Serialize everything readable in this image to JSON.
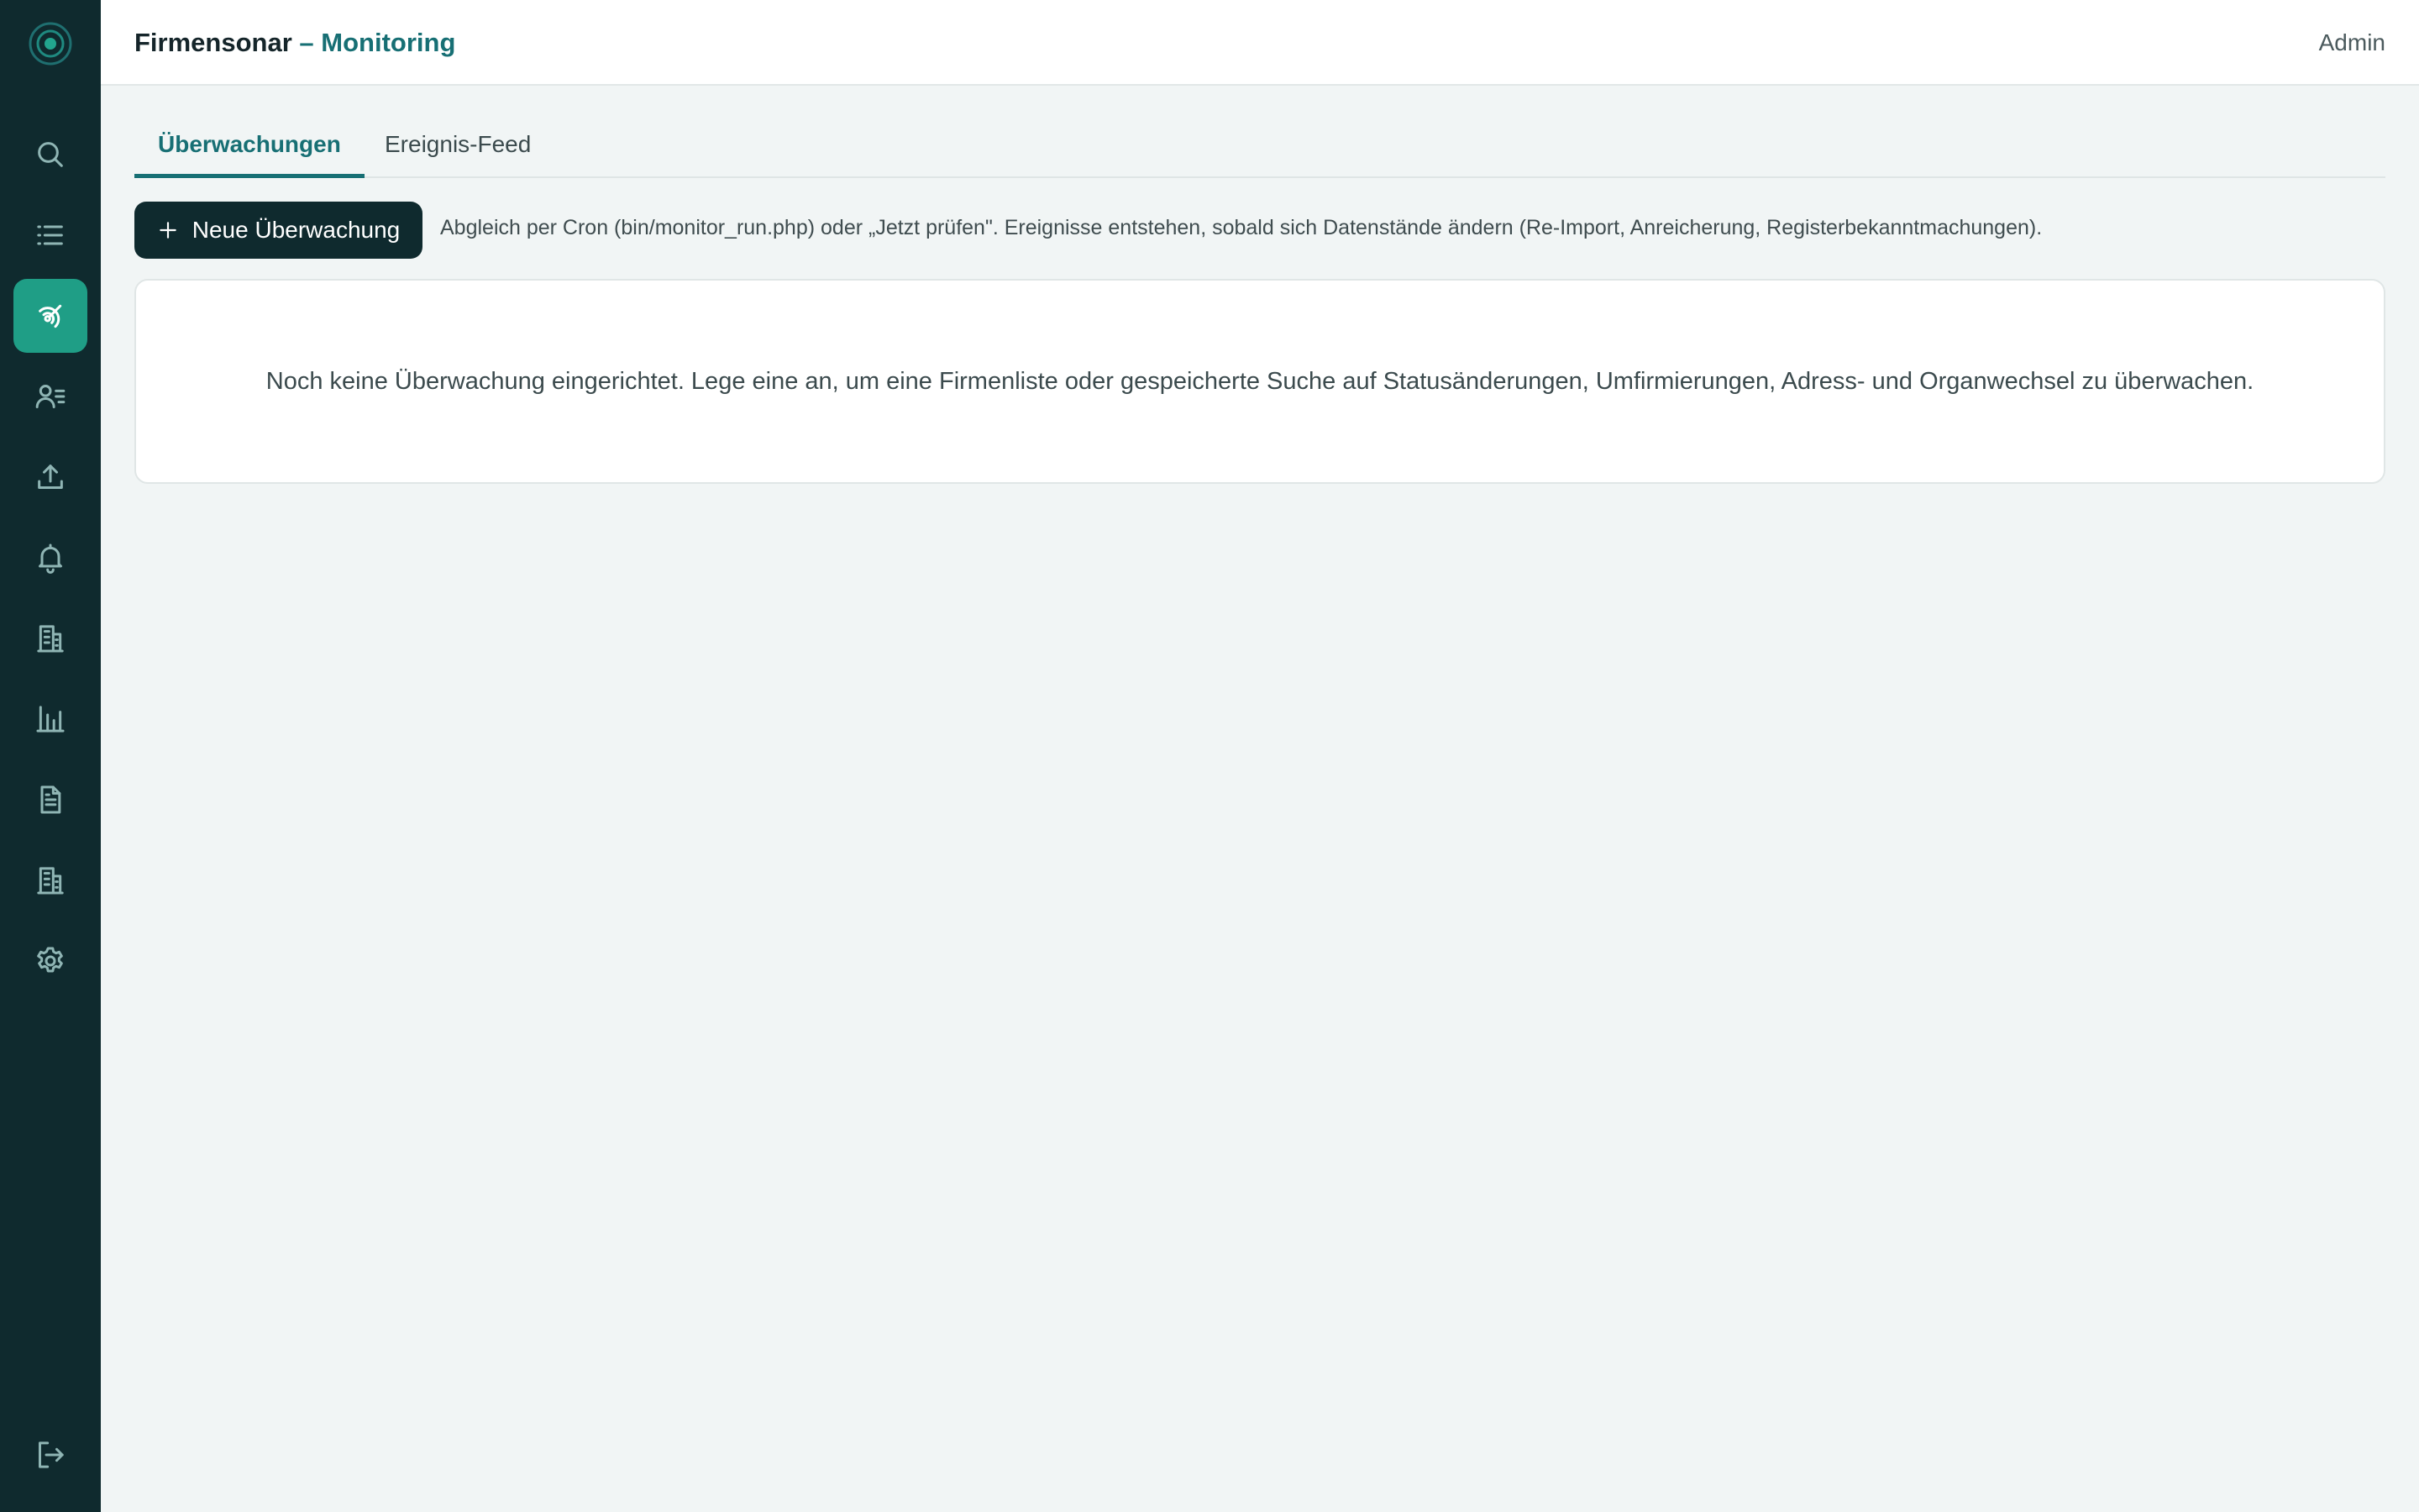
{
  "header": {
    "app_name": "Firmensonar",
    "section": "– Monitoring",
    "user": "Admin"
  },
  "sidebar": {
    "items": [
      {
        "icon": "search-icon",
        "active": false
      },
      {
        "icon": "list-icon",
        "active": false
      },
      {
        "icon": "radar-icon",
        "active": true
      },
      {
        "icon": "contacts-icon",
        "active": false
      },
      {
        "icon": "upload-icon",
        "active": false
      },
      {
        "icon": "bell-icon",
        "active": false
      },
      {
        "icon": "building-icon",
        "active": false
      },
      {
        "icon": "bar-chart-icon",
        "active": false
      },
      {
        "icon": "document-icon",
        "active": false
      },
      {
        "icon": "building-icon",
        "active": false
      },
      {
        "icon": "gear-icon",
        "active": false
      },
      {
        "icon": "logout-icon",
        "active": false
      }
    ]
  },
  "tabs": [
    {
      "label": "Überwachungen",
      "active": true
    },
    {
      "label": "Ereignis-Feed",
      "active": false
    }
  ],
  "toolbar": {
    "new_button_label": "Neue Überwachung",
    "hint": "Abgleich per Cron (bin/monitor_run.php) oder „Jetzt prüfen\". Ereignisse entstehen, sobald sich Datenstände ändern (Re-Import, Anreicherung, Registerbekanntmachungen)."
  },
  "empty_state": {
    "message": "Noch keine Überwachung eingerichtet. Lege eine an, um eine Firmenliste oder gespeicherte Suche auf Statusänderungen, Umfirmierungen, Adress- und Organwechsel zu überwachen."
  },
  "colors": {
    "sidebar_bg": "#0f2a2e",
    "accent": "#176f74",
    "active_nav": "#1f9e86",
    "page_bg": "#f1f5f5"
  }
}
